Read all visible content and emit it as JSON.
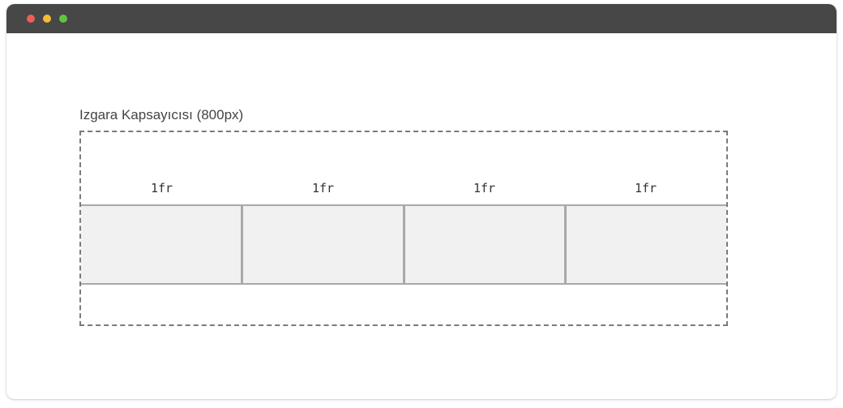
{
  "window": {
    "titlebar_color": "#474747",
    "controls": [
      {
        "name": "close",
        "color": "#ee5e57"
      },
      {
        "name": "minimize",
        "color": "#f5bb35"
      },
      {
        "name": "maximize",
        "color": "#5fc540"
      }
    ]
  },
  "diagram": {
    "container_label": "Izgara Kapsayıcısı (800px)",
    "tracks": [
      {
        "label": "1fr"
      },
      {
        "label": "1fr"
      },
      {
        "label": "1fr"
      },
      {
        "label": "1fr"
      }
    ],
    "colors": {
      "container_border": "#7a7a7a",
      "track_fill": "#f1f1f1",
      "track_border": "#a8a8a8"
    }
  }
}
